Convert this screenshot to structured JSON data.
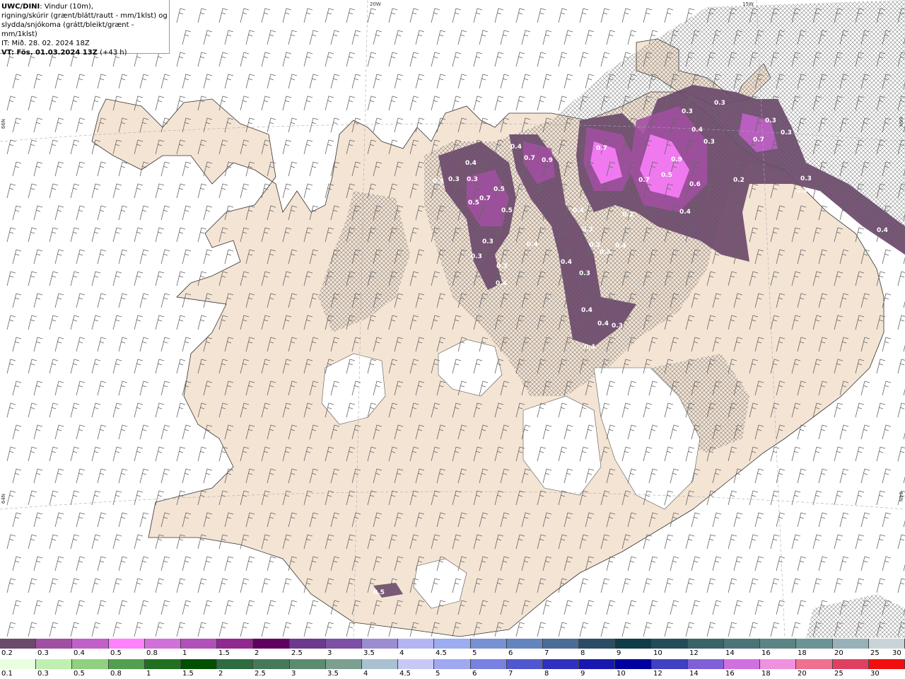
{
  "header": {
    "title": "UWC/DINI",
    "line1_rest": ": Vindur (10m),",
    "line2": "rigning/skúrir (grænt/blátt/rautt - mm/1klst) og",
    "line3": "slydda/snjókoma (grátt/bleikt/grænt - mm/1klst)",
    "line4": "IT: Mið. 28. 02. 2024 18Z",
    "line5_bold": "VT: Fös. 01.03.2024 13Z",
    "line5_rest": " (+43 h)"
  },
  "grid_labels": {
    "top_left": "20W",
    "top_right": "15W",
    "left_upper": "66N",
    "left_lower": "64N",
    "right_upper": "66N",
    "right_lower": "64N"
  },
  "map_values": [
    "0.3",
    "0.4",
    "0.3",
    "0.3",
    "0.5",
    "0.7",
    "0.5",
    "0.5",
    "0.3",
    "0.3",
    "0.3",
    "0.4",
    "0.4",
    "0.7",
    "0.9",
    "0.4",
    "0.4",
    "0.3",
    "0.3",
    "0.4",
    "0.3",
    "0.4",
    "0.4",
    "0.3",
    "0.4",
    "0.7",
    "0.9",
    "0.5",
    "0.6",
    "0.7",
    "0.3",
    "0.4",
    "0.3",
    "0.3",
    "0.3",
    "0.7",
    "0.3",
    "0.2",
    "0.3",
    "0.3",
    "0.4",
    "0.2",
    "0.3",
    "0.4",
    "0.4",
    "0.5"
  ],
  "legend_snow": {
    "labels": [
      "0.2",
      "0.3",
      "0.4",
      "0.5",
      "0.8",
      "1",
      "1.5",
      "2",
      "2.5",
      "3",
      "3.5",
      "4",
      "4.5",
      "5",
      "6",
      "7",
      "8",
      "9",
      "10",
      "12",
      "14",
      "16",
      "18",
      "20",
      "25",
      "30"
    ],
    "colors": [
      "#6b4a6b",
      "#a050a0",
      "#c060c8",
      "#ff80ff",
      "#d070d8",
      "#b050b8",
      "#902890",
      "#600060",
      "#6c3a8c",
      "#7c50a4",
      "#9c8cd0",
      "#b4b4f4",
      "#9cacf0",
      "#7890d4",
      "#6484c0",
      "#4c6c98",
      "#2c4c64",
      "#103c48",
      "#244c58",
      "#386468",
      "#4c7478",
      "#5c8484",
      "#6c9494",
      "#98b0b8",
      "#c8d4d8"
    ]
  },
  "legend_rain": {
    "labels": [
      "0.1",
      "0.3",
      "0.5",
      "0.8",
      "1",
      "1.5",
      "2",
      "2.5",
      "3",
      "3.5",
      "4",
      "4.5",
      "5",
      "6",
      "7",
      "8",
      "9",
      "10",
      "12",
      "14",
      "16",
      "18",
      "20",
      "25",
      "30"
    ],
    "colors": [
      "#e8ffe0",
      "#c0f0b0",
      "#90d080",
      "#50a050",
      "#207020",
      "#005000",
      "#2c6c40",
      "#447a58",
      "#5c8c70",
      "#7ca090",
      "#a8c0d0",
      "#c8c8f8",
      "#a0a8f0",
      "#7880e0",
      "#5058d0",
      "#3030c0",
      "#1818b0",
      "#0000a0",
      "#4040c0",
      "#8060d8",
      "#d070e0",
      "#f090e0",
      "#f07090",
      "#e04060",
      "#f01010"
    ]
  }
}
